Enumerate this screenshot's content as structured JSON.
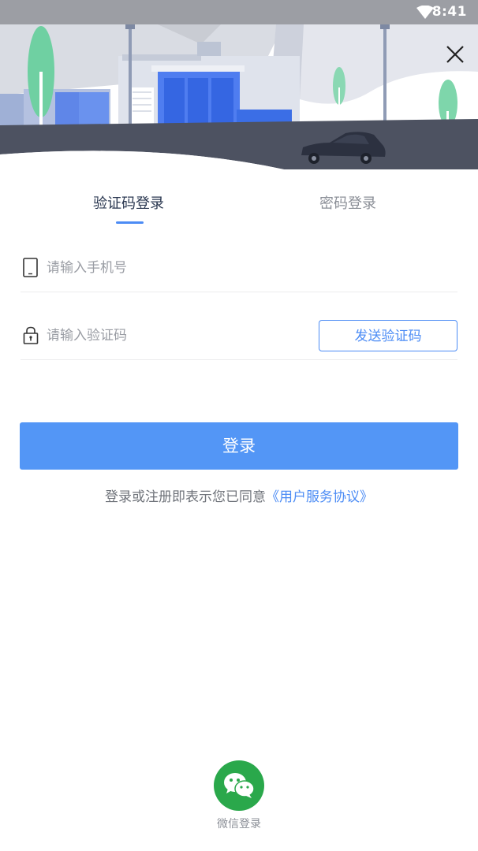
{
  "status_bar": {
    "time": "8:41",
    "wifi_icon": "wifi-icon"
  },
  "header": {
    "close_icon": "close-icon"
  },
  "tabs": [
    {
      "label": "验证码登录",
      "active": true
    },
    {
      "label": "密码登录",
      "active": false
    }
  ],
  "form": {
    "phone_placeholder": "请输入手机号",
    "phone_value": "",
    "code_placeholder": "请输入验证码",
    "code_value": "",
    "send_code_label": "发送验证码"
  },
  "login_button": "登录",
  "agreement": {
    "text": "登录或注册即表示您已同意",
    "link": "《用户服务协议》"
  },
  "wechat": {
    "label": "微信登录",
    "icon": "wechat-icon"
  },
  "colors": {
    "accent": "#4c8cf5",
    "button": "#5396f6",
    "wechat_green": "#2aa84b",
    "status_bar": "#9c9ea4"
  }
}
